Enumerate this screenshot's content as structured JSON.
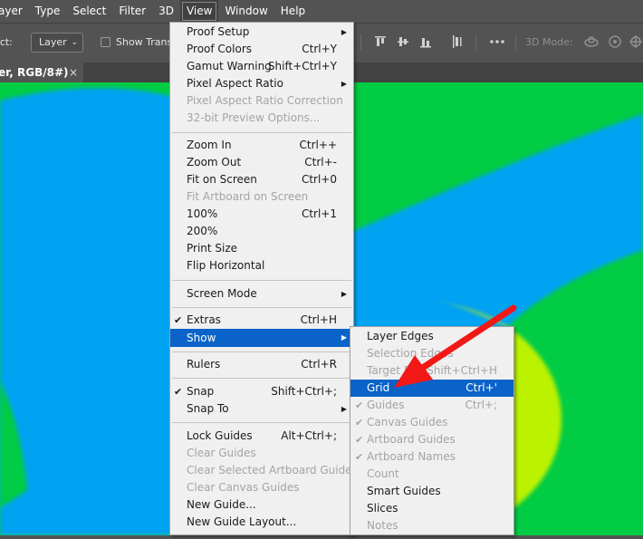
{
  "menubar": {
    "items": [
      "ayer",
      "Type",
      "Select",
      "Filter",
      "3D",
      "View",
      "Window",
      "Help"
    ],
    "active": "View"
  },
  "options": {
    "select_label": "lect:",
    "layer_dropdown": "Layer",
    "show_transform": "Show Trans",
    "mode_3d": "3D Mode:"
  },
  "document_tab": {
    "title": "er, RGB/8#)",
    "close": "×"
  },
  "view_menu": {
    "items": [
      {
        "label": "Proof Setup",
        "shortcut": "",
        "submenu": true,
        "disabled": false,
        "checked": false
      },
      {
        "label": "Proof Colors",
        "shortcut": "Ctrl+Y",
        "submenu": false,
        "disabled": false,
        "checked": false
      },
      {
        "label": "Gamut Warning",
        "shortcut": "Shift+Ctrl+Y",
        "submenu": false,
        "disabled": false,
        "checked": false
      },
      {
        "label": "Pixel Aspect Ratio",
        "shortcut": "",
        "submenu": true,
        "disabled": false,
        "checked": false
      },
      {
        "label": "Pixel Aspect Ratio Correction",
        "shortcut": "",
        "submenu": false,
        "disabled": true,
        "checked": false
      },
      {
        "label": "32-bit Preview Options...",
        "shortcut": "",
        "submenu": false,
        "disabled": true,
        "checked": false
      },
      {
        "label": "Zoom In",
        "shortcut": "Ctrl++",
        "submenu": false,
        "disabled": false,
        "checked": false
      },
      {
        "label": "Zoom Out",
        "shortcut": "Ctrl+-",
        "submenu": false,
        "disabled": false,
        "checked": false
      },
      {
        "label": "Fit on Screen",
        "shortcut": "Ctrl+0",
        "submenu": false,
        "disabled": false,
        "checked": false
      },
      {
        "label": "Fit Artboard on Screen",
        "shortcut": "",
        "submenu": false,
        "disabled": true,
        "checked": false
      },
      {
        "label": "100%",
        "shortcut": "Ctrl+1",
        "submenu": false,
        "disabled": false,
        "checked": false
      },
      {
        "label": "200%",
        "shortcut": "",
        "submenu": false,
        "disabled": false,
        "checked": false
      },
      {
        "label": "Print Size",
        "shortcut": "",
        "submenu": false,
        "disabled": false,
        "checked": false
      },
      {
        "label": "Flip Horizontal",
        "shortcut": "",
        "submenu": false,
        "disabled": false,
        "checked": false
      },
      {
        "label": "Screen Mode",
        "shortcut": "",
        "submenu": true,
        "disabled": false,
        "checked": false
      },
      {
        "label": "Extras",
        "shortcut": "Ctrl+H",
        "submenu": false,
        "disabled": false,
        "checked": true
      },
      {
        "label": "Show",
        "shortcut": "",
        "submenu": true,
        "disabled": false,
        "checked": false,
        "highlighted": true
      },
      {
        "label": "Rulers",
        "shortcut": "Ctrl+R",
        "submenu": false,
        "disabled": false,
        "checked": false
      },
      {
        "label": "Snap",
        "shortcut": "Shift+Ctrl+;",
        "submenu": false,
        "disabled": false,
        "checked": true
      },
      {
        "label": "Snap To",
        "shortcut": "",
        "submenu": true,
        "disabled": false,
        "checked": false
      },
      {
        "label": "Lock Guides",
        "shortcut": "Alt+Ctrl+;",
        "submenu": false,
        "disabled": false,
        "checked": false
      },
      {
        "label": "Clear Guides",
        "shortcut": "",
        "submenu": false,
        "disabled": true,
        "checked": false
      },
      {
        "label": "Clear Selected Artboard Guides",
        "shortcut": "",
        "submenu": false,
        "disabled": true,
        "checked": false
      },
      {
        "label": "Clear Canvas Guides",
        "shortcut": "",
        "submenu": false,
        "disabled": true,
        "checked": false
      },
      {
        "label": "New Guide...",
        "shortcut": "",
        "submenu": false,
        "disabled": false,
        "checked": false
      },
      {
        "label": "New Guide Layout...",
        "shortcut": "",
        "submenu": false,
        "disabled": false,
        "checked": false
      }
    ]
  },
  "show_submenu": {
    "items": [
      {
        "label": "Layer Edges",
        "shortcut": "",
        "disabled": false,
        "checked": false
      },
      {
        "label": "Selection Edges",
        "shortcut": "",
        "disabled": true,
        "checked": false
      },
      {
        "label": "Target Path",
        "shortcut": "Shift+Ctrl+H",
        "disabled": true,
        "checked": false
      },
      {
        "label": "Grid",
        "shortcut": "Ctrl+'",
        "disabled": false,
        "checked": false,
        "highlighted": true
      },
      {
        "label": "Guides",
        "shortcut": "Ctrl+;",
        "disabled": true,
        "checked": true
      },
      {
        "label": "Canvas Guides",
        "shortcut": "",
        "disabled": true,
        "checked": true
      },
      {
        "label": "Artboard Guides",
        "shortcut": "",
        "disabled": true,
        "checked": true
      },
      {
        "label": "Artboard Names",
        "shortcut": "",
        "disabled": true,
        "checked": true
      },
      {
        "label": "Count",
        "shortcut": "",
        "disabled": true,
        "checked": false
      },
      {
        "label": "Smart Guides",
        "shortcut": "",
        "disabled": false,
        "checked": false
      },
      {
        "label": "Slices",
        "shortcut": "",
        "disabled": false,
        "checked": false
      },
      {
        "label": "Notes",
        "shortcut": "",
        "disabled": true,
        "checked": false
      }
    ]
  },
  "glyphs": {
    "check": "✔",
    "submenu_arrow": "▶",
    "chevron": "⌄"
  },
  "colors": {
    "canvas_green": "#00cc44",
    "canvas_blue": "#00a2f2",
    "canvas_yellow": "#bbf200",
    "menu_highlight": "#0a63c9",
    "annotation_arrow": "#f21818"
  }
}
